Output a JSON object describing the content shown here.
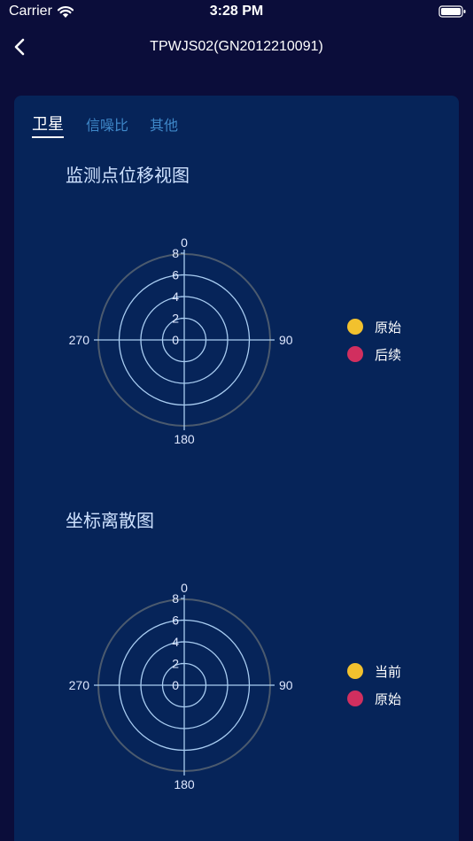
{
  "status_bar": {
    "carrier": "Carrier",
    "time": "3:28 PM"
  },
  "nav": {
    "title": "TPWJS02(GN2012210091)"
  },
  "tabs": [
    {
      "label": "卫星",
      "active": true
    },
    {
      "label": "信噪比",
      "active": false
    },
    {
      "label": "其他",
      "active": false
    }
  ],
  "charts": [
    {
      "title": "监测点位移视图",
      "legend": [
        {
          "label": "原始",
          "color": "#f2c12e"
        },
        {
          "label": "后续",
          "color": "#d12f5f"
        }
      ]
    },
    {
      "title": "坐标离散图",
      "legend": [
        {
          "label": "当前",
          "color": "#f2c12e"
        },
        {
          "label": "原始",
          "color": "#d12f5f"
        }
      ]
    }
  ],
  "chart_data": [
    {
      "type": "scatter",
      "coordinate_system": "polar",
      "title": "监测点位移视图",
      "angle_ticks": [
        "0",
        "90",
        "180",
        "270"
      ],
      "radius_ticks": [
        "0",
        "2",
        "4",
        "6",
        "8"
      ],
      "rlim": [
        0,
        8
      ],
      "series": [
        {
          "name": "原始",
          "color": "#f2c12e",
          "points": []
        },
        {
          "name": "后续",
          "color": "#d12f5f",
          "points": []
        }
      ],
      "legend_position": "right"
    },
    {
      "type": "scatter",
      "coordinate_system": "polar",
      "title": "坐标离散图",
      "angle_ticks": [
        "0",
        "90",
        "180",
        "270"
      ],
      "radius_ticks": [
        "0",
        "2",
        "4",
        "6",
        "8"
      ],
      "rlim": [
        0,
        8
      ],
      "series": [
        {
          "name": "当前",
          "color": "#f2c12e",
          "points": []
        },
        {
          "name": "原始",
          "color": "#d12f5f",
          "points": []
        }
      ],
      "legend_position": "right"
    }
  ]
}
